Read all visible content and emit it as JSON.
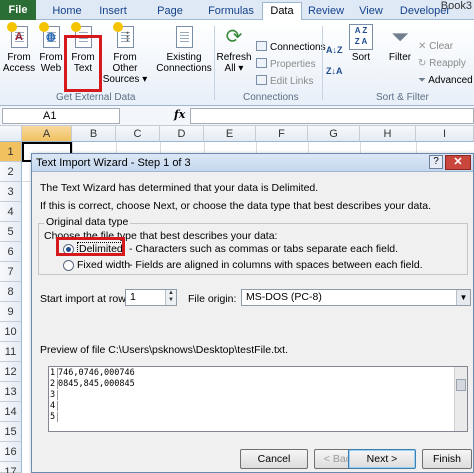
{
  "app": {
    "book_title": "Book3"
  },
  "tabs": [
    "File",
    "Home",
    "Insert",
    "Page Layout",
    "Formulas",
    "Data",
    "Review",
    "View",
    "Developer"
  ],
  "ribbon": {
    "get_external_data": {
      "label": "Get External Data",
      "buttons": [
        {
          "line1": "From",
          "line2": "Access",
          "icon": "access-icon"
        },
        {
          "line1": "From",
          "line2": "Web",
          "icon": "web-icon"
        },
        {
          "line1": "From",
          "line2": "Text",
          "icon": "text-file-icon"
        },
        {
          "line1": "From Other",
          "line2": "Sources ▾",
          "icon": "other-sources-icon"
        },
        {
          "line1": "Existing",
          "line2": "Connections",
          "icon": "existing-connections-icon"
        }
      ]
    },
    "connections": {
      "label": "Connections",
      "refresh_line1": "Refresh",
      "refresh_line2": "All ▾",
      "items": [
        "Connections",
        "Properties",
        "Edit Links"
      ]
    },
    "sort_filter": {
      "label": "Sort & Filter",
      "sort": "Sort",
      "filter": "Filter",
      "items": [
        "Clear",
        "Reapply",
        "Advanced"
      ]
    }
  },
  "formula_bar": {
    "name_box": "A1",
    "fx": "fx"
  },
  "grid": {
    "columns": [
      "A",
      "B",
      "C",
      "D",
      "E",
      "F",
      "G",
      "H",
      "I"
    ],
    "rows": [
      "1",
      "2",
      "3",
      "4",
      "5",
      "6",
      "7",
      "8",
      "9",
      "10",
      "11",
      "12",
      "13",
      "14",
      "15",
      "16",
      "17"
    ]
  },
  "dialog": {
    "title": "Text Import Wizard - Step 1 of 3",
    "help": "?",
    "close": "✕",
    "intro1": "The Text Wizard has determined that your data is Delimited.",
    "intro2": "If this is correct, choose Next, or choose the data type that best describes your data.",
    "group_label": "Original data type",
    "choose_label": "Choose the file type that best describes your data:",
    "delimited_label": "Delimited",
    "delimited_desc": "- Characters such as commas or tabs separate each field.",
    "fixed_label": "Fixed width",
    "fixed_desc": "- Fields are aligned in columns with spaces between each field.",
    "start_row_label": "Start import at row:",
    "start_row_value": "1",
    "origin_label": "File origin:",
    "origin_value": "MS-DOS (PC-8)",
    "preview_label": "Preview of file C:\\Users\\psknows\\Desktop\\testFile.txt.",
    "preview_lines": [
      {
        "num": "1",
        "text": "746,0746,000746"
      },
      {
        "num": "2",
        "text": "0845,845,000845"
      },
      {
        "num": "3",
        "text": ""
      },
      {
        "num": "4",
        "text": ""
      },
      {
        "num": "5",
        "text": ""
      }
    ],
    "buttons": {
      "cancel": "Cancel",
      "back": "< Back",
      "next": "Next >",
      "finish": "Finish"
    }
  }
}
